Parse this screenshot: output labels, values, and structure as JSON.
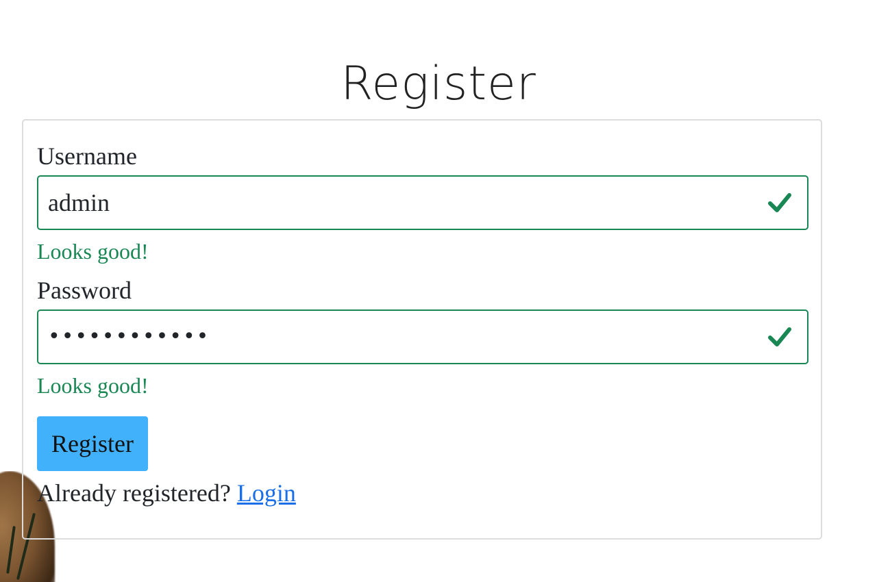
{
  "page": {
    "title": "Register"
  },
  "form": {
    "username": {
      "label": "Username",
      "value": "admin",
      "feedback": "Looks good!"
    },
    "password": {
      "label": "Password",
      "value": "••••••••••••",
      "feedback": "Looks good!"
    },
    "submit_label": "Register",
    "login_prompt": "Already registered?",
    "login_link": "Login"
  },
  "colors": {
    "valid": "#198754",
    "button": "#41b1fb",
    "link": "#1a6fe8"
  },
  "icons": {
    "valid": "check-icon"
  }
}
